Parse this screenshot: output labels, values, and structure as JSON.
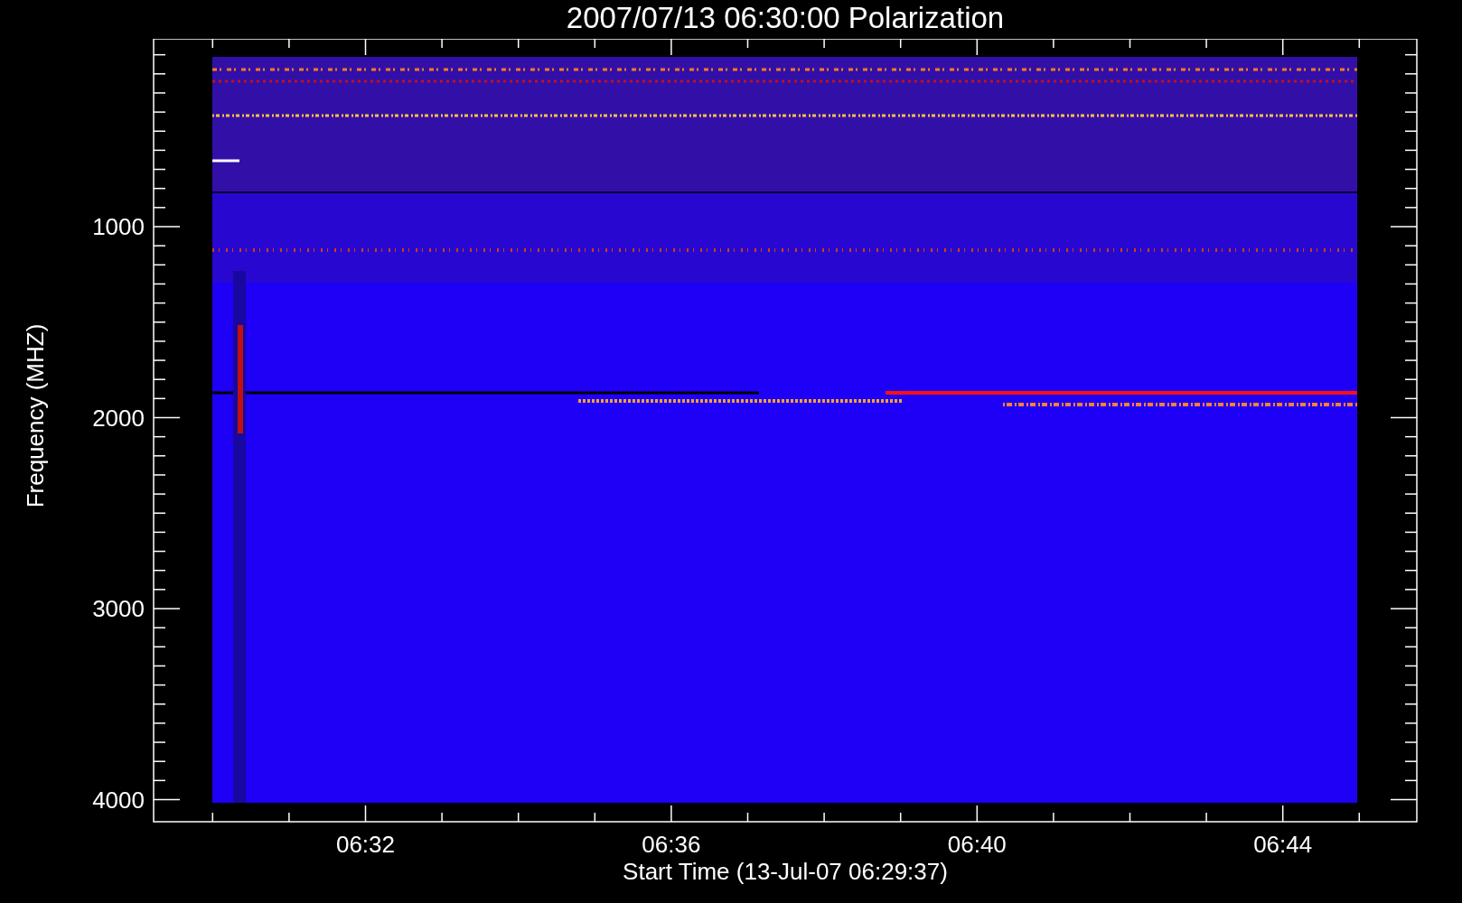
{
  "title": "2007/07/13 06:30:00 Polarization",
  "plot": {
    "ylabel": "Frequency (MHZ)",
    "xlabel": "Start Time (13-Jul-07 06:29:37)",
    "yticks": [
      "1000",
      "2000",
      "3000",
      "4000"
    ],
    "xticks": [
      "06:32",
      "06:36",
      "06:40",
      "06:44"
    ]
  }
}
